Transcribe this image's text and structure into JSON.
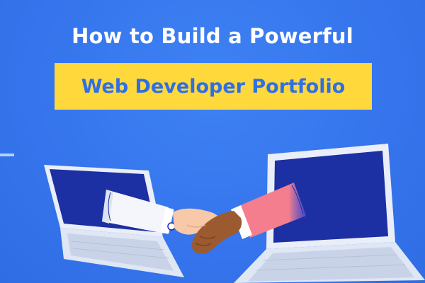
{
  "title": {
    "line1": "How to Build a Powerful",
    "line2": "Web Developer Portfolio"
  },
  "colors": {
    "background": "#3779f0",
    "highlight_box": "#ffd83b",
    "highlight_text": "#2f6fe6",
    "title_text": "#ffffff"
  },
  "illustration": {
    "left_device": "laptop-icon",
    "right_device": "laptop-icon",
    "center": "handshake-icon"
  }
}
